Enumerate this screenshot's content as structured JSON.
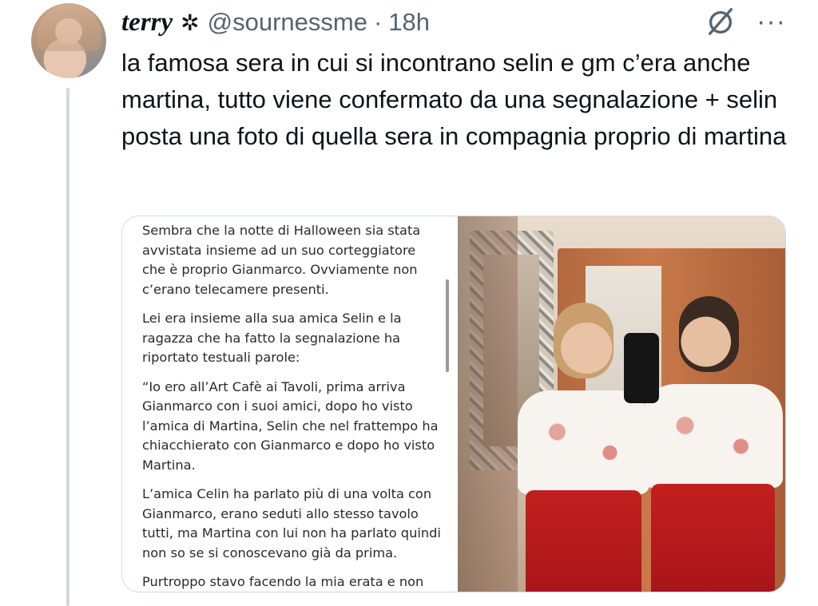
{
  "author": {
    "display_name": "terry",
    "name_badge": "✲",
    "handle": "@sournessme",
    "separator": "·",
    "time": "18h"
  },
  "icons": {
    "grok": "grok-icon",
    "more": "more-icon",
    "more_glyph": "···"
  },
  "tweet": {
    "text": "la famosa sera in cui si incontrano selin e gm c’era anche martina, tutto viene confermato da una segnalazione + selin posta una foto di quella sera in compagnia proprio di martina"
  },
  "article": {
    "paragraphs": [
      "Sembra che la notte di Halloween sia stata avvistata insieme ad un suo corteggiatore che è proprio Gianmarco. Ovviamente non c’erano telecamere presenti.",
      "Lei era insieme alla sua amica Selin e la ragazza che ha fatto la segnalazione ha riportato testuali parole:",
      "“Io ero all’Art Cafè ai Tavoli, prima arriva Gianmarco con i suoi amici, dopo ho visto l’amica di Martina, Selin che nel frattempo ha chiacchierato con Gianmarco e dopo ho visto Martina.",
      "L’amica Celin ha parlato più di una volta con Gianmarco, erano seduti allo stesso tavolo tutti, ma Martina con lui non ha parlato quindi non so se si conoscevano già da prima.",
      "Purtroppo stavo facendo la mia erata e non sono riuscita a fare la foto.”"
    ]
  },
  "colors": {
    "text": "#0f1419",
    "secondary": "#536471",
    "border": "#cfd9de"
  }
}
